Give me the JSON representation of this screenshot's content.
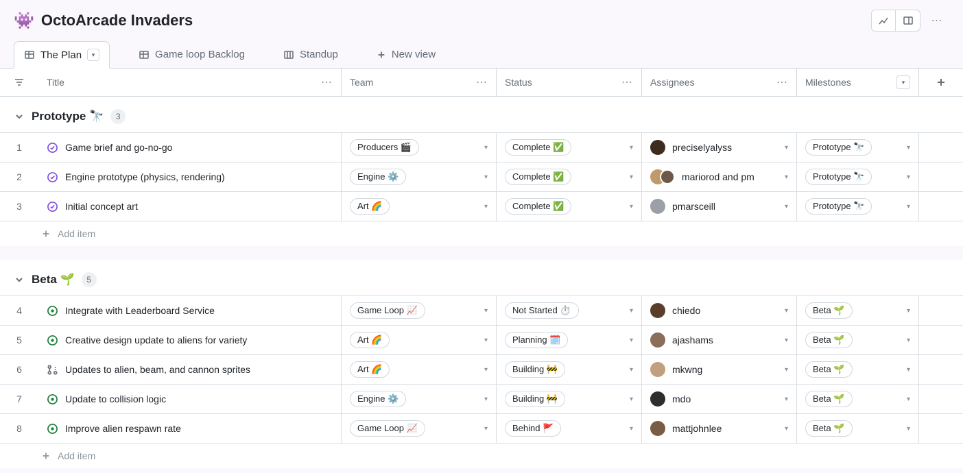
{
  "header": {
    "emoji": "👾",
    "title": "OctoArcade Invaders"
  },
  "tabs": {
    "active": {
      "label": "The Plan"
    },
    "items": [
      {
        "label": "Game loop Backlog"
      },
      {
        "label": "Standup"
      }
    ],
    "new": "New view"
  },
  "columns": {
    "title": "Title",
    "team": "Team",
    "status": "Status",
    "assignees": "Assignees",
    "milestones": "Milestones"
  },
  "groups": [
    {
      "name": "Prototype",
      "emoji": "🔭",
      "count": "3",
      "rows": [
        {
          "num": "1",
          "state": "done",
          "title": "Game brief and go-no-go",
          "team": "Producers 🎬",
          "status": "Complete ✅",
          "assignee": {
            "name": "preciselyalyss",
            "color": "#3d2b1f"
          },
          "milestone": "Prototype 🔭"
        },
        {
          "num": "2",
          "state": "done",
          "title": "Engine prototype (physics, rendering)",
          "team": "Engine ⚙️",
          "status": "Complete ✅",
          "assignee": {
            "name": "mariorod and pm",
            "multi": true,
            "color1": "#c19a6b",
            "color2": "#6e5849"
          },
          "milestone": "Prototype 🔭"
        },
        {
          "num": "3",
          "state": "done",
          "title": "Initial concept art",
          "team": "Art 🌈",
          "status": "Complete ✅",
          "assignee": {
            "name": "pmarsceill",
            "color": "#9aa0a6"
          },
          "milestone": "Prototype 🔭"
        }
      ],
      "add": "Add item"
    },
    {
      "name": "Beta",
      "emoji": "🌱",
      "count": "5",
      "rows": [
        {
          "num": "4",
          "state": "open",
          "title": "Integrate with Leaderboard Service",
          "team": "Game Loop 📈",
          "status": "Not Started ⏱️",
          "assignee": {
            "name": "chiedo",
            "color": "#5a3e2b"
          },
          "milestone": "Beta 🌱"
        },
        {
          "num": "5",
          "state": "open",
          "title": "Creative design update to aliens for variety",
          "team": "Art 🌈",
          "status": "Planning 🗓️",
          "assignee": {
            "name": "ajashams",
            "color": "#8a6d5a"
          },
          "milestone": "Beta 🌱"
        },
        {
          "num": "6",
          "state": "pr",
          "title": "Updates to alien, beam, and cannon sprites",
          "team": "Art 🌈",
          "status": "Building 🚧",
          "assignee": {
            "name": "mkwng",
            "color": "#c0a080"
          },
          "milestone": "Beta 🌱"
        },
        {
          "num": "7",
          "state": "open",
          "title": "Update to collision logic",
          "team": "Engine ⚙️",
          "status": "Building 🚧",
          "assignee": {
            "name": "mdo",
            "color": "#2e2e2e"
          },
          "milestone": "Beta 🌱"
        },
        {
          "num": "8",
          "state": "open",
          "title": "Improve alien respawn rate",
          "team": "Game Loop 📈",
          "status": "Behind 🚩",
          "assignee": {
            "name": "mattjohnlee",
            "color": "#7a5c44"
          },
          "milestone": "Beta 🌱"
        }
      ],
      "add": "Add item"
    }
  ]
}
